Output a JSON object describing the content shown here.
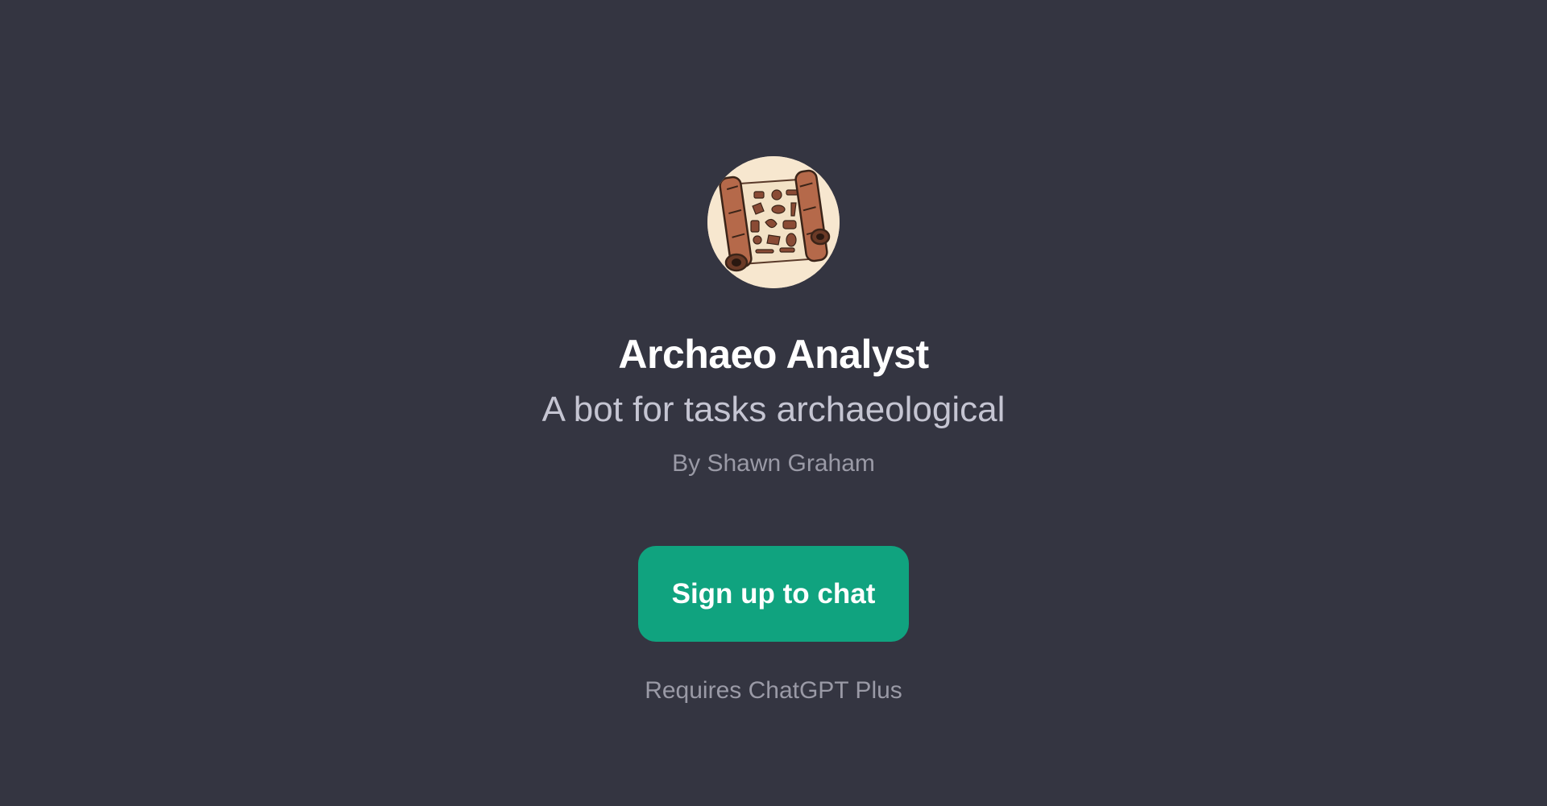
{
  "gpt": {
    "name": "Archaeo Analyst",
    "description": "A bot for tasks archaeological",
    "author": "By Shawn Graham",
    "avatar_icon": "unrolled-scroll-with-artifacts-icon"
  },
  "actions": {
    "signup_label": "Sign up to chat",
    "requirement": "Requires ChatGPT Plus"
  },
  "colors": {
    "background": "#343541",
    "button": "#10a37f",
    "title": "#ffffff",
    "subtitle": "#c5c5d2",
    "muted": "#9a9aa6"
  }
}
